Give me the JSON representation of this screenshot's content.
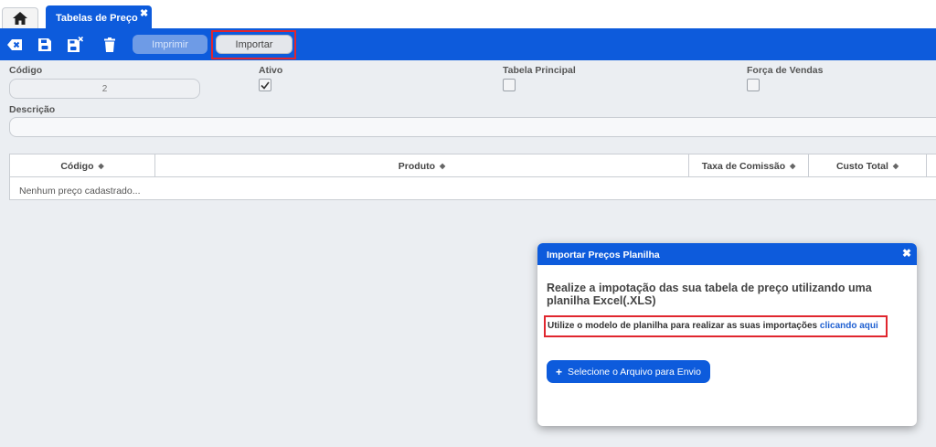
{
  "tabs": {
    "home_icon": "home-icon",
    "active_label": "Tabelas de Preço",
    "close_glyph": "✖"
  },
  "toolbar": {
    "icons": [
      "backspace-x-icon",
      "save-icon",
      "save-close-icon",
      "trash-icon"
    ],
    "imprimir_label": "Imprimir",
    "importar_label": "Importar",
    "accent_color": "#0d5bdc"
  },
  "form": {
    "codigo_label": "Código",
    "codigo_value": "2",
    "ativo_label": "Ativo",
    "ativo_checked": true,
    "tabela_principal_label": "Tabela Principal",
    "tabela_principal_checked": false,
    "forca_vendas_label": "Força de Vendas",
    "forca_vendas_checked": false,
    "descricao_label": "Descrição",
    "descricao_value": ""
  },
  "table": {
    "columns": [
      "Código",
      "Produto",
      "Taxa de Comissão",
      "Custo Total"
    ],
    "empty_message": "Nenhum preço cadastrado..."
  },
  "modal": {
    "title": "Importar Preços Planilha",
    "close_glyph": "✖",
    "message": "Realize a impotação das sua tabela de preço utilizando uma planilha Excel(.XLS)",
    "hint_text": "Utilize o modelo de planilha para realizar as suas importações ",
    "hint_link": "clicando aqui",
    "upload_icon": "+",
    "upload_label": "Selecione o Arquivo para Envio"
  },
  "highlight_color": "#e0262e"
}
